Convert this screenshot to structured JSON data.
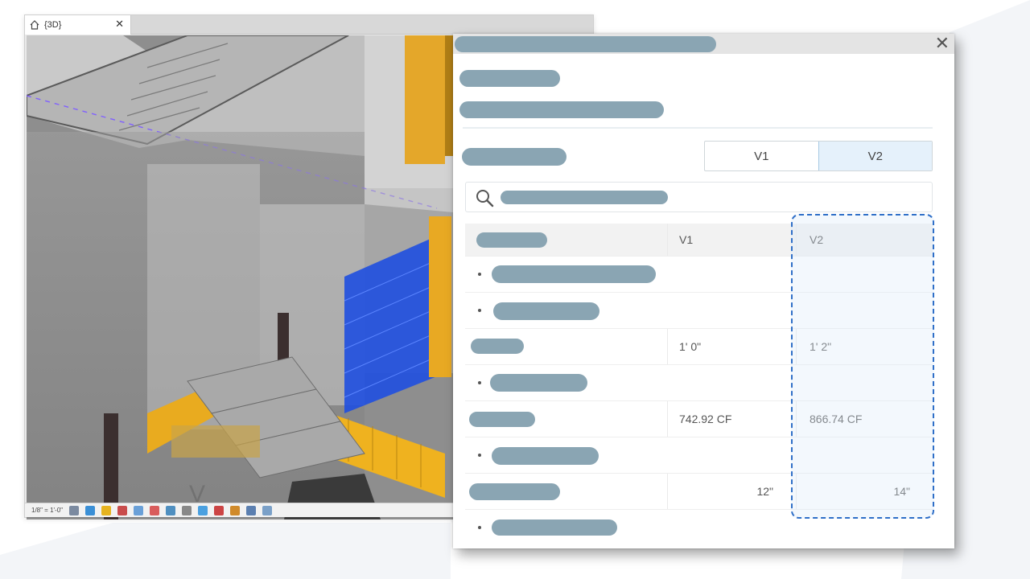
{
  "viewport": {
    "tab_label": "{3D}",
    "close_glyph": "✕",
    "scale_text": "1/8\" = 1'-0\"",
    "icons": [
      "house-icon"
    ],
    "colors": {
      "accent_yellow": "#f0b321",
      "accent_blue": "#1f4fe0"
    }
  },
  "panel": {
    "close_glyph": "✕",
    "toggle": {
      "v1_label": "V1",
      "v2_label": "V2",
      "active": "V2"
    },
    "table": {
      "header": {
        "v1": "V1",
        "v2": "V2"
      },
      "rows": [
        {
          "type": "group"
        },
        {
          "type": "group"
        },
        {
          "type": "value",
          "v1": "1' 0\"",
          "v2": "1' 2\""
        },
        {
          "type": "group"
        },
        {
          "type": "value",
          "v1": "742.92 CF",
          "v2": "866.74 CF"
        },
        {
          "type": "group"
        },
        {
          "type": "value",
          "v1": "12\"",
          "v2": "14\""
        },
        {
          "type": "group"
        }
      ]
    },
    "colors": {
      "placeholder_bar": "#8aa5b3",
      "highlight": "#2f6fc8",
      "active_toggle": "#e5f1fb"
    }
  }
}
